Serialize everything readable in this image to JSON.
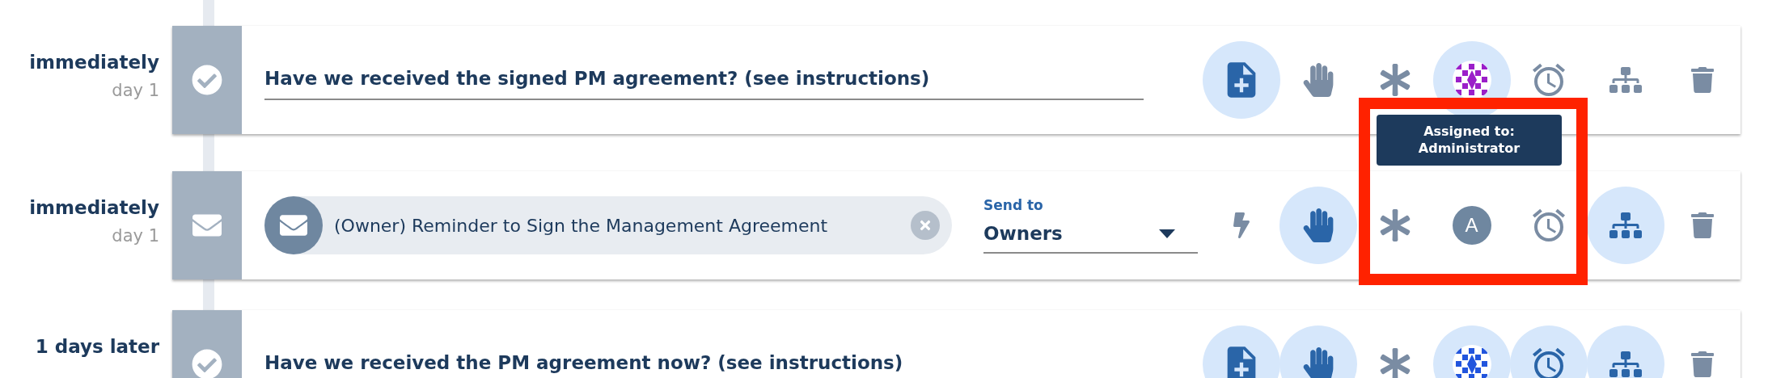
{
  "steps": [
    {
      "timing": "immediately",
      "day": "day 1",
      "kind": "task",
      "title": "Have we received the signed PM agreement? (see instructions)",
      "actions": [
        {
          "kind": "document",
          "active": true
        },
        {
          "kind": "hand",
          "active": false
        },
        {
          "kind": "asterisk",
          "active": false
        },
        {
          "kind": "avatar",
          "active": true,
          "color": "#9b1fc9"
        },
        {
          "kind": "alarm",
          "active": false
        },
        {
          "kind": "sitemap",
          "active": false
        },
        {
          "kind": "trash",
          "active": false
        }
      ]
    },
    {
      "timing": "immediately",
      "day": "day 1",
      "kind": "email",
      "title": "(Owner) Reminder to Sign the Management Agreement",
      "send_to": {
        "label": "Send to",
        "value": "Owners"
      },
      "actions": [
        {
          "kind": "bolt",
          "active": false
        },
        {
          "kind": "hand",
          "active": true
        },
        {
          "kind": "asterisk",
          "active": false
        },
        {
          "kind": "initial",
          "label": "A",
          "active": false
        },
        {
          "kind": "alarm",
          "active": false
        },
        {
          "kind": "sitemap",
          "active": true
        },
        {
          "kind": "trash",
          "active": false
        }
      ]
    },
    {
      "timing": "1 days later",
      "kind": "task",
      "title": "Have we received the PM agreement now? (see instructions)",
      "actions": [
        {
          "kind": "document",
          "active": true
        },
        {
          "kind": "hand",
          "active": true
        },
        {
          "kind": "asterisk",
          "active": false
        },
        {
          "kind": "avatar",
          "active": true,
          "color": "#2255dd"
        },
        {
          "kind": "alarm",
          "active": true
        },
        {
          "kind": "sitemap",
          "active": true
        },
        {
          "kind": "trash",
          "active": false
        }
      ]
    }
  ],
  "tooltip": {
    "text": "Assigned to: Administrator"
  }
}
